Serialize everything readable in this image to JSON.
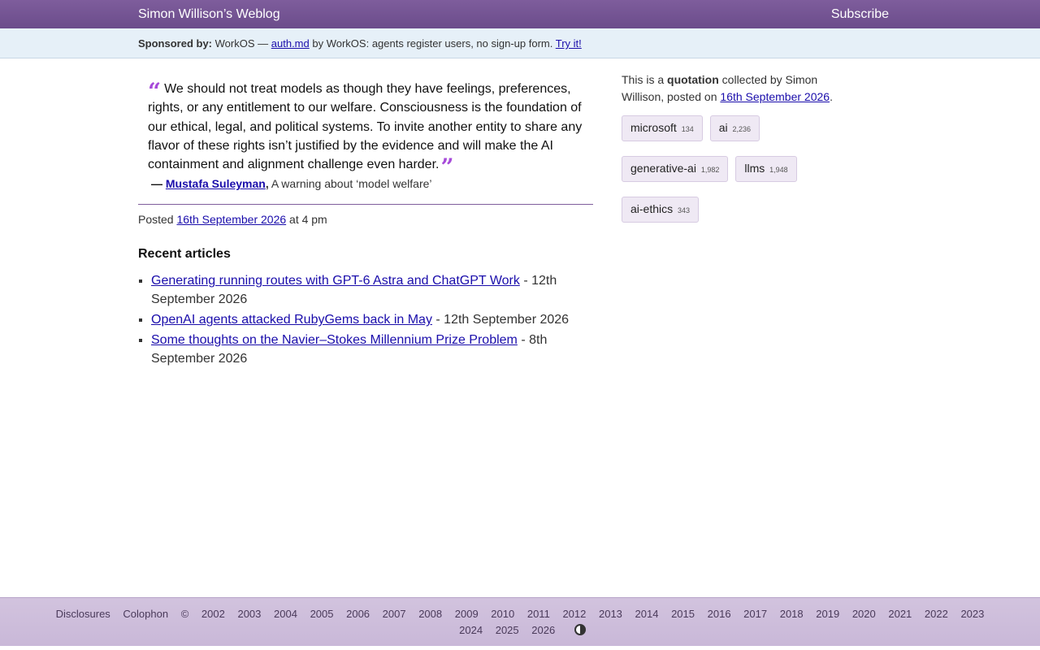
{
  "header": {
    "site_title": "Simon Willison’s Weblog",
    "subscribe": "Subscribe"
  },
  "sponsor": {
    "label": "Sponsored by:",
    "company": "WorkOS —",
    "link": "auth.md",
    "text": "by WorkOS: agents register users, no sign-up form.",
    "cta": "Try it!"
  },
  "quote": {
    "text": "We should not treat models as though they have feelings, preferences, rights, or any entitlement to our welfare. Consciousness is the foundation of our ethical, legal, and political systems. To invite another entity to share any flavor of these rights isn’t justified by the evidence and will make the AI containment and alignment challenge even harder.",
    "open_mark": "“",
    "close_mark": "”",
    "dash": "—",
    "author": "Mustafa Suleyman",
    "comma": ",",
    "source": "A warning about ‘model welfare’"
  },
  "posted": {
    "prefix": "Posted",
    "date": "16th September 2026",
    "suffix": "at 4 pm"
  },
  "recent": {
    "heading": "Recent articles",
    "items": [
      {
        "title": "Generating running routes with GPT-6 Astra and ChatGPT Work",
        "date": "- 12th September 2026"
      },
      {
        "title": "OpenAI agents attacked RubyGems back in May",
        "date": "- 12th September 2026"
      },
      {
        "title": "Some thoughts on the Navier–Stokes Millennium Prize Problem",
        "date": "- 8th September 2026"
      }
    ]
  },
  "sidebar": {
    "intro_pre": "This is a",
    "intro_bold": "quotation",
    "intro_post": "collected by Simon Willison, posted on",
    "date": "16th September 2026",
    "period": ".",
    "tags": [
      {
        "name": "microsoft",
        "count": "134"
      },
      {
        "name": "ai",
        "count": "2,236"
      },
      {
        "name": "generative-ai",
        "count": "1,982"
      },
      {
        "name": "llms",
        "count": "1,948"
      },
      {
        "name": "ai-ethics",
        "count": "343"
      }
    ]
  },
  "footer": {
    "disclosures": "Disclosures",
    "colophon": "Colophon",
    "copyright": "©",
    "years": [
      "2002",
      "2003",
      "2004",
      "2005",
      "2006",
      "2007",
      "2008",
      "2009",
      "2010",
      "2011",
      "2012",
      "2013",
      "2014",
      "2015",
      "2016",
      "2017",
      "2018",
      "2019",
      "2020",
      "2021",
      "2022",
      "2023",
      "2024",
      "2025",
      "2026"
    ],
    "theme_icon": "contrast-icon"
  },
  "colors": {
    "header_purple": "#7e5d9c",
    "quote_mark": "#a64ad9",
    "sponsor_bg": "#e6f0f8",
    "tag_bg": "#efe9f4"
  }
}
